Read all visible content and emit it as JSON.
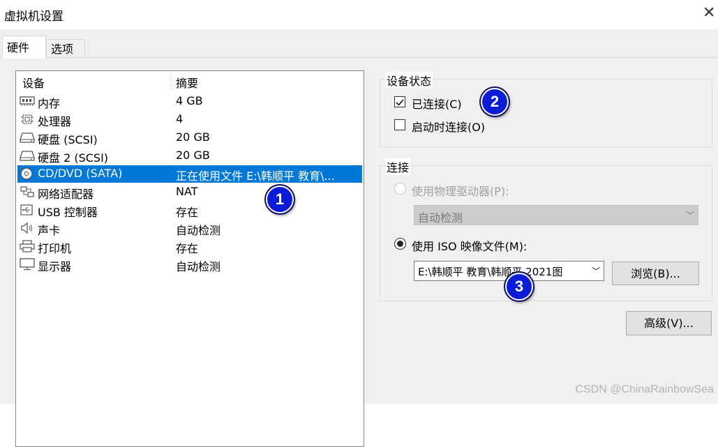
{
  "window": {
    "title": "虚拟机设置",
    "close_glyph": "✕"
  },
  "tabs": [
    {
      "label": "硬件",
      "active": true
    },
    {
      "label": "选项",
      "active": false
    }
  ],
  "device_list": {
    "headers": {
      "device": "设备",
      "summary": "摘要"
    },
    "rows": [
      {
        "name": "内存",
        "summary": "4 GB",
        "icon": "memory-icon"
      },
      {
        "name": "处理器",
        "summary": "4",
        "icon": "cpu-icon"
      },
      {
        "name": "硬盘 (SCSI)",
        "summary": "20 GB",
        "icon": "hard-disk-icon"
      },
      {
        "name": "硬盘 2 (SCSI)",
        "summary": "20 GB",
        "icon": "hard-disk-icon"
      },
      {
        "name": "CD/DVD (SATA)",
        "summary": "正在使用文件 E:\\韩顺平 教育\\...",
        "icon": "cd-dvd-icon",
        "selected": true
      },
      {
        "name": "网络适配器",
        "summary": "NAT",
        "icon": "network-adapter-icon"
      },
      {
        "name": "USB 控制器",
        "summary": "存在",
        "icon": "usb-icon"
      },
      {
        "name": "声卡",
        "summary": "自动检测",
        "icon": "speaker-icon"
      },
      {
        "name": "打印机",
        "summary": "存在",
        "icon": "printer-icon"
      },
      {
        "name": "显示器",
        "summary": "自动检测",
        "icon": "monitor-icon"
      }
    ]
  },
  "device_status": {
    "title": "设备状态",
    "connected": {
      "label": "已连接(C)",
      "checked": true
    },
    "connect_at_power_on": {
      "label": "启动时连接(O)",
      "checked": false
    }
  },
  "connection": {
    "title": "连接",
    "physical_drive": {
      "label": "使用物理驱动器(P):",
      "selected": false,
      "enabled": false,
      "value": "自动检测"
    },
    "iso_image": {
      "label": "使用 ISO 映像文件(M):",
      "selected": true,
      "value": "E:\\韩顺平 教育\\韩顺平 2021图"
    },
    "browse_label": "浏览(B)..."
  },
  "advanced_label": "高级(V)...",
  "badges": [
    "1",
    "2",
    "3"
  ],
  "watermark": "CSDN @ChinaRainbowSea",
  "colors": {
    "selection": "#0078d7",
    "badge": "#0a1cd6"
  }
}
